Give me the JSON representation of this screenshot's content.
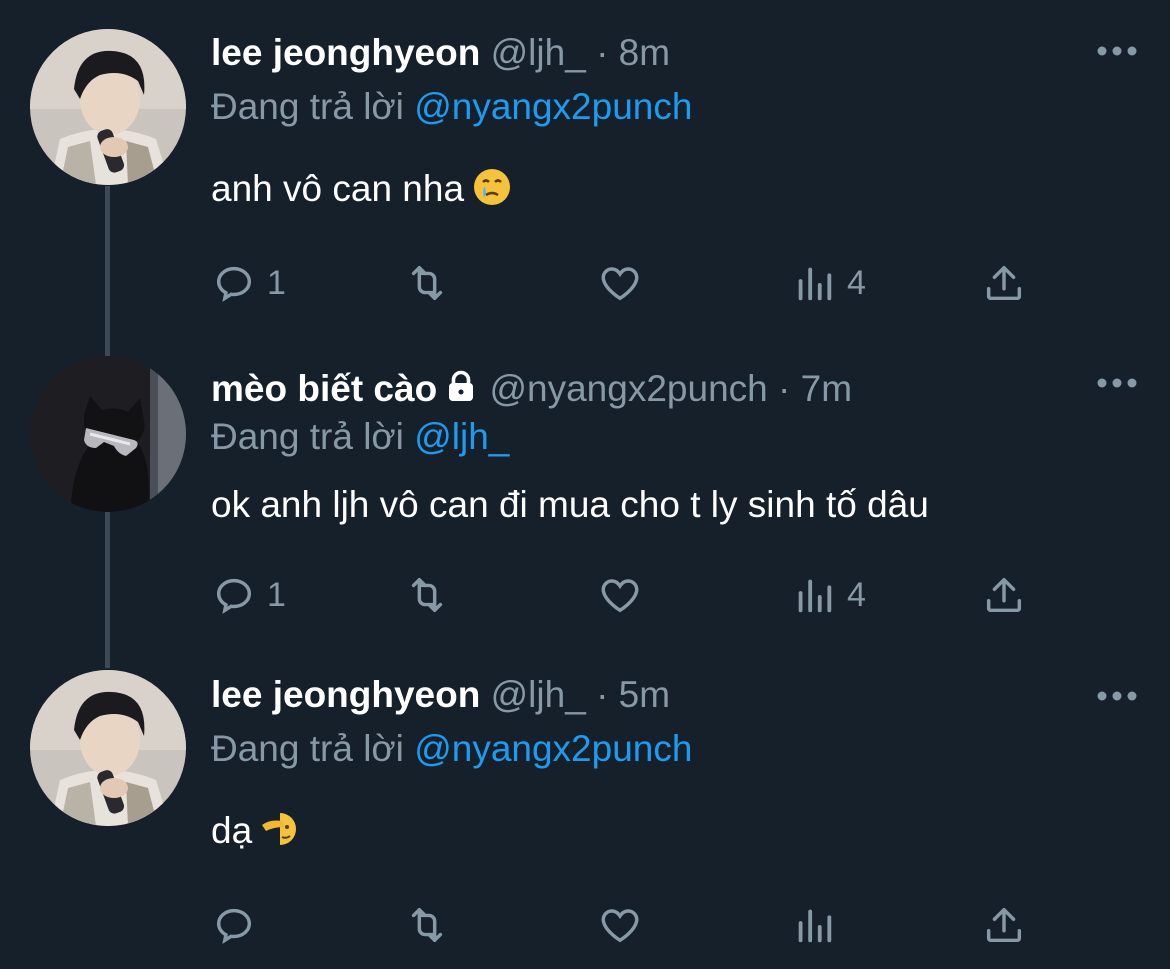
{
  "colors": {
    "background": "#15202b",
    "text": "#ffffff",
    "secondary": "#8899a6",
    "link": "#1d9bf0",
    "thread_line": "#3d4a56"
  },
  "tweets": [
    {
      "name": "lee jeonghyeon",
      "handle": "@ljh_",
      "separator": "·",
      "time": "8m",
      "replying_prefix": "Đang trả lời",
      "replying_to": "@nyangx2punch",
      "text": "anh vô can nha",
      "emoji": "crying-face-emoji",
      "reply_count": "1",
      "view_count": "4",
      "locked": false
    },
    {
      "name": "mèo biết cào",
      "handle": "@nyangx2punch",
      "separator": "·",
      "time": "7m",
      "replying_prefix": "Đang trả lời",
      "replying_to": "@ljh_",
      "text": "ok anh ljh vô can đi mua cho t ly sinh tố dâu",
      "emoji": "",
      "reply_count": "1",
      "view_count": "4",
      "locked": true
    },
    {
      "name": "lee jeonghyeon",
      "handle": "@ljh_",
      "separator": "·",
      "time": "5m",
      "replying_prefix": "Đang trả lời",
      "replying_to": "@nyangx2punch",
      "text": "dạ",
      "emoji": "saluting-face-emoji",
      "reply_count": "",
      "view_count": "",
      "locked": false
    }
  ]
}
